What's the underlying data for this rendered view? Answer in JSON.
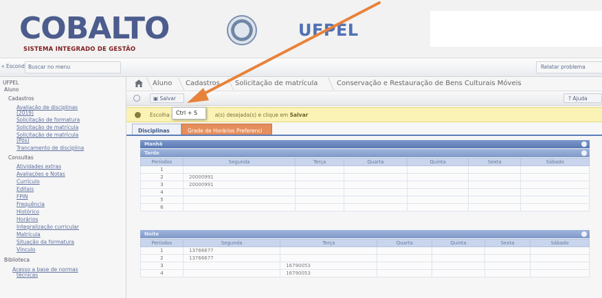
{
  "header": {
    "logo_text": "COBALTO",
    "logo_subtitle": "SISTEMA INTEGRADO DE GESTÃO",
    "institution": "UFPEL"
  },
  "topbar": {
    "hide_menu": "« Esconder menu",
    "search_menu": "Buscar no menu",
    "report_problem": "Relatar problema"
  },
  "sidebar": {
    "root": "UFPEL",
    "aluno": "Aluno",
    "cadastros": "Cadastros",
    "cadastros_items": [
      "Avaliação de disciplinas",
      "(2019)",
      "Solicitação de formatura",
      "Solicitação de matrícula",
      "Solicitação de matrícula",
      "(Pós)",
      "Trancamento de disciplina"
    ],
    "consultas": "Consultas",
    "consultas_items": [
      "Atividades extras",
      "Avaliações e Notas",
      "Currículo",
      "Editais",
      "FPIN",
      "Frequência",
      "Histórico",
      "Horários",
      "Integralização curricular",
      "Matrícula",
      "Situação da formatura",
      "Vínculo"
    ],
    "biblioteca": "Biblioteca",
    "biblioteca_items": [
      "Acesso a base de normas",
      "técnicas"
    ]
  },
  "breadcrumb": {
    "items": [
      "Aluno",
      "Cadastros",
      "Solicitação de matrícula",
      "Conservação e Restauração de Bens Culturais Móveis"
    ]
  },
  "actionbar": {
    "save_label": "Salvar",
    "help_label": "Ajuda"
  },
  "notice": {
    "prefix": "Escolha a(",
    "middle": "a(s) desejada(s) e clique em",
    "action": "Salvar"
  },
  "tooltip": {
    "text": "Ctrl + S"
  },
  "tabs": [
    "Disciplinas",
    "Grade de Horários Preferenci"
  ],
  "grid": {
    "manha_title": "Manhã",
    "tarde_title": "Tarde",
    "noite_title": "Noite",
    "columns": [
      "Períodos",
      "Segunda",
      "Terça",
      "Quarta",
      "Quinta",
      "Sexta",
      "Sábado"
    ],
    "tarde_rows": [
      [
        "1",
        "",
        "",
        "",
        "",
        "",
        ""
      ],
      [
        "2",
        "20000991",
        "",
        "",
        "",
        "",
        ""
      ],
      [
        "3",
        "20000991",
        "",
        "",
        "",
        "",
        ""
      ],
      [
        "4",
        "",
        "",
        "",
        "",
        "",
        ""
      ],
      [
        "5",
        "",
        "",
        "",
        "",
        "",
        ""
      ],
      [
        "6",
        "",
        "",
        "",
        "",
        "",
        ""
      ]
    ],
    "noite_rows": [
      [
        "1",
        "13766677",
        "",
        "",
        "",
        "",
        ""
      ],
      [
        "2",
        "13766677",
        "",
        "",
        "",
        "",
        ""
      ],
      [
        "3",
        "",
        "16790053",
        "",
        "",
        "",
        ""
      ],
      [
        "4",
        "",
        "16790053",
        "",
        "",
        "",
        ""
      ]
    ]
  },
  "colors": {
    "brand_blue": "#4c5d8d",
    "header_bar_blue": "#5b78b2",
    "tab_orange": "#e58e5b",
    "notice_yellow": "#fbf3b6",
    "arrow_orange": "#e8823a"
  }
}
